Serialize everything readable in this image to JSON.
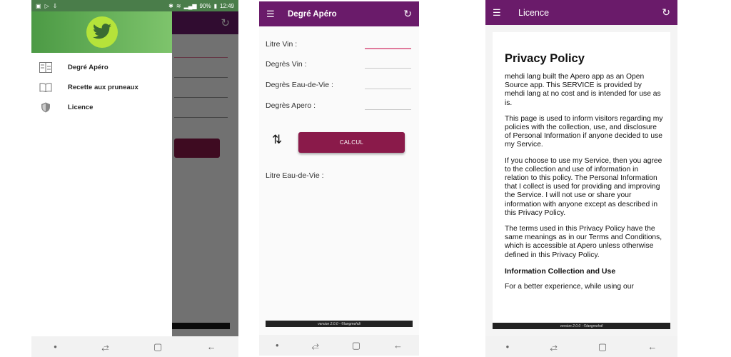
{
  "phone1": {
    "status": {
      "battery": "90%",
      "time": "12:49"
    },
    "drawer": {
      "items": [
        {
          "label": "Degré Apéro",
          "icon": "calculator-icon"
        },
        {
          "label": "Recette aux pruneaux",
          "icon": "book-icon"
        },
        {
          "label": "Licence",
          "icon": "shield-icon"
        }
      ]
    }
  },
  "phone2": {
    "title": "Degré Apéro",
    "fields": [
      {
        "label": "Litre Vin :"
      },
      {
        "label": "Degrès Vin :"
      },
      {
        "label": "Degrès Eau-de-Vie :"
      },
      {
        "label": "Degrès Apero :"
      }
    ],
    "calc_button": "CALCUL",
    "result_label": "Litre Eau-de-Vie :",
    "version": "version 2.0.0 - ©langmehdi"
  },
  "phone3": {
    "title": "Licence",
    "heading": "Privacy Policy",
    "paragraphs": [
      "mehdi lang built the Apero app as an Open Source app. This SERVICE is provided by mehdi lang at no cost and is intended for use as is.",
      "This page is used to inform visitors regarding my policies with the collection, use, and disclosure of Personal Information if anyone decided to use my Service.",
      "If you choose to use my Service, then you agree to the collection and use of information in relation to this policy. The Personal Information that I collect is used for providing and improving the Service. I will not use or share your information with anyone except as described in this Privacy Policy.",
      "The terms used in this Privacy Policy have the same meanings as in our Terms and Conditions, which is accessible at Apero unless otherwise defined in this Privacy Policy."
    ],
    "subheading": "Information Collection and Use",
    "last_paragraph": "For a better experience, while using our",
    "version": "version 2.0.0 - ©langmehdi"
  },
  "colors": {
    "primary": "#6a1b6a",
    "accent_button": "#8a1a4a",
    "drawer_header": "#5aa850"
  }
}
